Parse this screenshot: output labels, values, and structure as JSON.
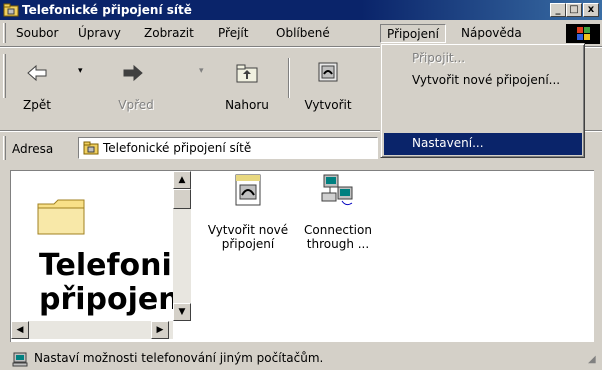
{
  "window": {
    "title": "Telefonické připojení sítě",
    "buttons": {
      "minimize": "_",
      "maximize": "□",
      "close": "x"
    }
  },
  "menubar": {
    "items": [
      {
        "label": "Soubor"
      },
      {
        "label": "Úpravy"
      },
      {
        "label": "Zobrazit"
      },
      {
        "label": "Přejít"
      },
      {
        "label": "Oblíbené"
      },
      {
        "label": "Připojení",
        "active": true
      },
      {
        "label": "Nápověda"
      }
    ]
  },
  "dropdown": {
    "items": [
      {
        "label": "Připojit...",
        "state": "disabled"
      },
      {
        "label": "Vytvořit nové připojení..."
      },
      {
        "label": "Nastavení...",
        "state": "highlighted"
      }
    ]
  },
  "toolbar": {
    "back": "Zpět",
    "forward": "Vpřed",
    "up": "Nahoru",
    "create": "Vytvořit"
  },
  "address": {
    "label": "Adresa",
    "value": "Telefonické připojení sítě"
  },
  "left_pane": {
    "title_line1": "Telefoni",
    "title_line2": "připojen"
  },
  "icons": [
    {
      "name": "Vytvořit nové připojení",
      "line1": "Vytvořit nové",
      "line2": "připojení",
      "icon": "make-new-connection-icon"
    },
    {
      "name": "Connection through ...",
      "line1": "Connection",
      "line2": "through ...",
      "icon": "connection-icon"
    }
  ],
  "status": {
    "text": "Nastaví možnosti telefonování jiným počítačům."
  },
  "colors": {
    "titlebar": "#0a246a",
    "face": "#d4d0c8",
    "highlight": "#0a246a"
  }
}
